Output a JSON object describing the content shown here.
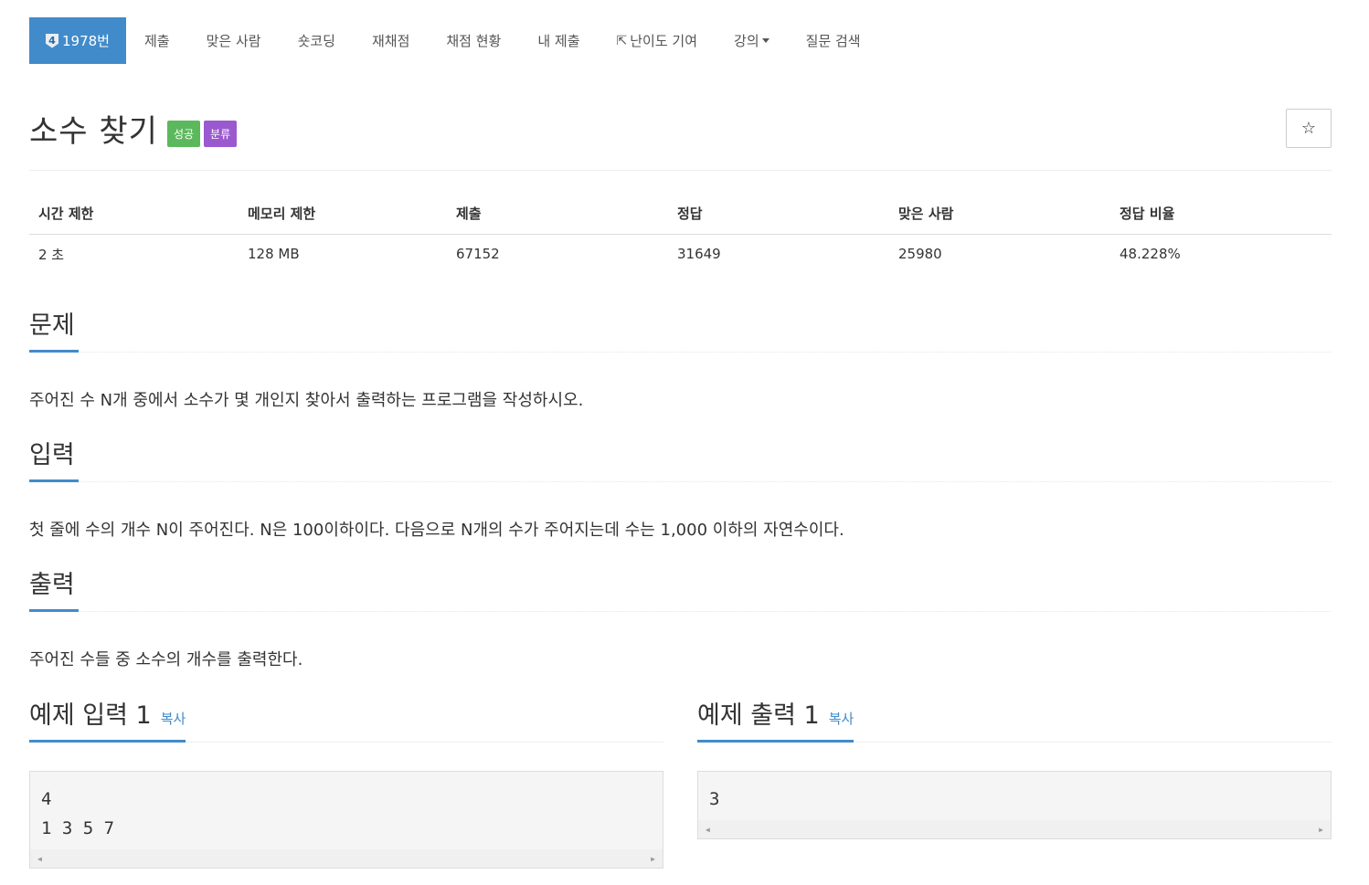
{
  "nav": {
    "problem_badge": "4",
    "problem_id": "1978번",
    "items": [
      "제출",
      "맞은 사람",
      "숏코딩",
      "재채점",
      "채점 현황",
      "내 제출",
      "난이도 기여",
      "강의",
      "질문 검색"
    ]
  },
  "problem": {
    "title": "소수 찾기",
    "labels": [
      "성공",
      "분류"
    ],
    "star": "☆"
  },
  "info": {
    "headers": [
      "시간 제한",
      "메모리 제한",
      "제출",
      "정답",
      "맞은 사람",
      "정답 비율"
    ],
    "values": [
      "2 초",
      "128 MB",
      "67152",
      "31649",
      "25980",
      "48.228%"
    ]
  },
  "sections": {
    "description_title": "문제",
    "description": "주어진 수 N개 중에서 소수가 몇 개인지 찾아서 출력하는 프로그램을 작성하시오.",
    "input_title": "입력",
    "input": "첫 줄에 수의 개수 N이 주어진다. N은 100이하이다. 다음으로 N개의 수가 주어지는데 수는 1,000 이하의 자연수이다.",
    "output_title": "출력",
    "output": "주어진 수들 중 소수의 개수를 출력한다."
  },
  "samples": {
    "input_title": "예제 입력 1",
    "output_title": "예제 출력 1",
    "copy_label": "복사",
    "input_text": "4\n1 3 5 7",
    "output_text": "3"
  },
  "colors": {
    "primary": "#428bca",
    "success": "#5cb85c",
    "purple": "#9b59d0"
  }
}
